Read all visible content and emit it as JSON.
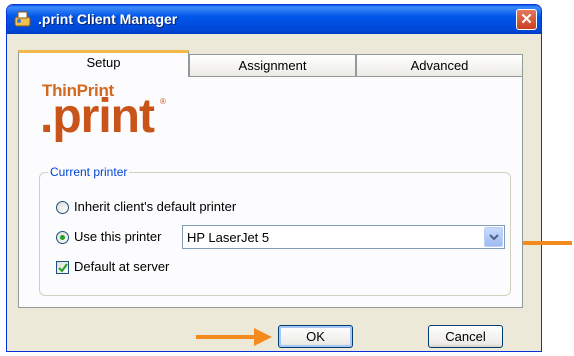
{
  "window": {
    "title": ".print Client Manager",
    "close_symbol": "✕"
  },
  "tabs": [
    {
      "label": "Setup",
      "active": true
    },
    {
      "label": "Assignment",
      "active": false
    },
    {
      "label": "Advanced",
      "active": false
    }
  ],
  "logo": {
    "top": "ThinPrint",
    "main": ".print",
    "reg": "®"
  },
  "current_printer": {
    "legend": "Current printer",
    "inherit_label": "Inherit client's default printer",
    "inherit_selected": false,
    "use_label": "Use this printer",
    "use_selected": true,
    "printer_value": "HP LaserJet 5",
    "default_label": "Default at server",
    "default_checked": true
  },
  "buttons": {
    "ok": "OK",
    "cancel": "Cancel"
  },
  "colors": {
    "annotation_arrow": "#f28a1e",
    "logo": "#c8541a",
    "group_legend": "#0046d5"
  },
  "icons": [
    "app-icon",
    "close-icon",
    "chevron-down-icon",
    "checkmark-icon",
    "arrow-left-icon",
    "arrow-right-icon"
  ]
}
